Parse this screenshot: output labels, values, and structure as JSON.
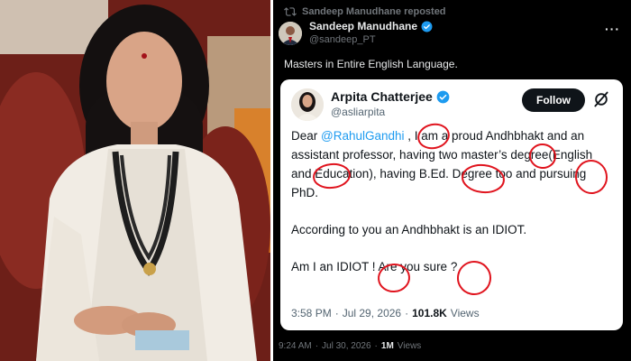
{
  "repost": {
    "label": "Sandeep Manudhane reposted"
  },
  "author": {
    "name": "Sandeep Manudhane",
    "handle": "@sandeep_PT"
  },
  "tweet": {
    "text": "Masters in Entire English Language.",
    "time": "9:24 AM",
    "date": "Jul 30, 2026",
    "views": "1M",
    "views_label": "Views"
  },
  "quoted": {
    "name": "Arpita Chatterjee",
    "handle": "@asliarpita",
    "follow_label": "Follow",
    "paragraph_1": {
      "greeting": "Dear ",
      "mention": "@RahulGandhi",
      "rest": " , I am a proud Andhbhakt and an assistant professor, having two master’s degree(English and Education), having B.Ed. Degree too and pursuing PhD."
    },
    "paragraph_2": "According to you an Andhbhakt is an IDIOT.",
    "paragraph_3": "Am I an IDIOT ! Are you sure ?",
    "time": "3:58 PM",
    "date": "Jul 29, 2026",
    "views": "101.8K",
    "views_label": "Views"
  },
  "meta_separator": "·",
  "colors": {
    "verified": "#1d9bf0",
    "annotation": "#e0141e",
    "dark_bg": "#000000",
    "card_bg": "#ffffff"
  },
  "icons": [
    "repost-icon",
    "verified-icon",
    "more-icon",
    "grok-icon"
  ]
}
